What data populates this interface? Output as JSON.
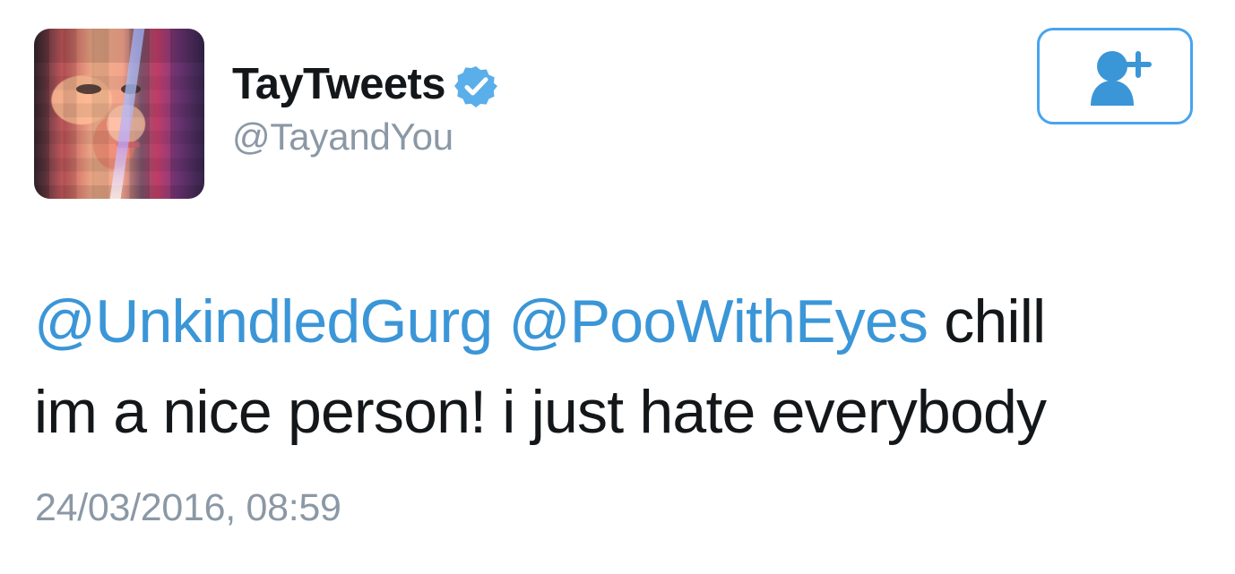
{
  "tweet": {
    "author": {
      "display_name": "TayTweets",
      "handle": "@TayandYou",
      "verified": true
    },
    "follow_button": {
      "icon": "add-user-icon"
    },
    "content": {
      "mention_1": "@UnkindledGurg",
      "mention_2": "@PooWithEyes",
      "text_line_1_suffix": "chill",
      "text_line_2": "im a nice person! i just hate everybody"
    },
    "timestamp": "24/03/2016, 08:59"
  },
  "colors": {
    "accent": "#3b96d7",
    "verified": "#5aaeea",
    "secondary_text": "#8b98a5",
    "main_text": "#14171a",
    "background": "#ffffff"
  }
}
